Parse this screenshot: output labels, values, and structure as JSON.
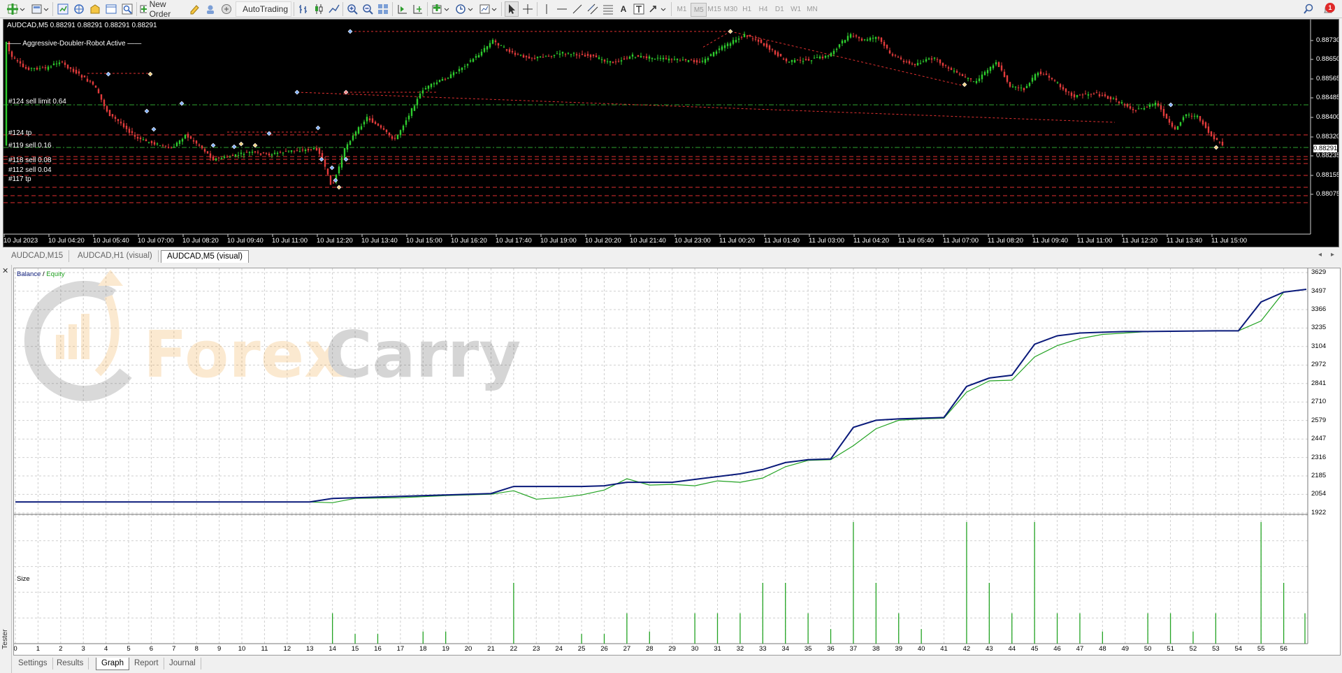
{
  "toolbar": {
    "new_order_label": "New Order",
    "autotrading_label": "AutoTrading",
    "timeframes": [
      "M1",
      "M5",
      "M15",
      "M30",
      "H1",
      "H4",
      "D1",
      "W1",
      "MN"
    ],
    "active_timeframe": "M5",
    "notification_count": "1",
    "icons": [
      "new-chart-icon",
      "profiles-icon",
      "market-watch-icon",
      "navigator-icon",
      "data-window-icon",
      "terminal-icon",
      "strategy-tester-icon",
      "metaeditor-icon",
      "signals-icon",
      "market-icon",
      "bar-chart-icon",
      "candlestick-icon",
      "line-chart-icon",
      "zoom-in-icon",
      "zoom-out-icon",
      "tile-windows-icon",
      "autoscroll-icon",
      "chart-shift-icon",
      "indicators-icon",
      "periods-icon",
      "templates-icon",
      "cursor-icon",
      "crosshair-icon",
      "vertical-line-icon",
      "horizontal-line-icon",
      "trendline-icon",
      "equidistant-channel-icon",
      "fibonacci-icon",
      "text-icon",
      "text-label-icon",
      "arrows-icon",
      "search-icon",
      "notifications-icon"
    ]
  },
  "chart": {
    "title": "AUDCAD,M5  0.88291 0.88291 0.88291 0.88291",
    "robot_label": "Aggressive-Doubler-Robot Active",
    "price_ticks": [
      "0.88730",
      "0.88650",
      "0.88565",
      "0.88485",
      "0.88400",
      "0.88320",
      "0.88235",
      "0.88155",
      "0.88075"
    ],
    "current_price": "0.88291",
    "time_ticks": [
      "10 Jul 2023",
      "10 Jul 04:20",
      "10 Jul 05:40",
      "10 Jul 07:00",
      "10 Jul 08:20",
      "10 Jul 09:40",
      "10 Jul 11:00",
      "10 Jul 12:20",
      "10 Jul 13:40",
      "10 Jul 15:00",
      "10 Jul 16:20",
      "10 Jul 17:40",
      "10 Jul 19:00",
      "10 Jul 20:20",
      "10 Jul 21:40",
      "10 Jul 23:00",
      "11 Jul 00:20",
      "11 Jul 01:40",
      "11 Jul 03:00",
      "11 Jul 04:20",
      "11 Jul 05:40",
      "11 Jul 07:00",
      "11 Jul 08:20",
      "11 Jul 09:40",
      "11 Jul 11:00",
      "11 Jul 12:20",
      "11 Jul 13:40",
      "11 Jul 15:00"
    ],
    "order_labels": [
      "#124 sell limit 0.64",
      "#124 tp",
      "#119 sell 0.16",
      "#118 sell 0.08",
      "#112 sell 0.04",
      "#117 tp"
    ],
    "colors": {
      "bull": "#2ecc2e",
      "bear": "#e23b3b",
      "order_line": "#e03030",
      "limit_line": "#2fa52f"
    }
  },
  "chart_tabs": [
    {
      "label": "AUDCAD,M15",
      "active": false
    },
    {
      "label": "AUDCAD,H1 (visual)",
      "active": false
    },
    {
      "label": "AUDCAD,M5 (visual)",
      "active": true
    }
  ],
  "tester": {
    "side_label": "Tester",
    "legend_balance": "Balance",
    "legend_sep": " / ",
    "legend_equity": "Equity",
    "size_label": "Size",
    "watermark_text": "ForexCarry",
    "tabs": [
      "Settings",
      "Results",
      "Graph",
      "Report",
      "Journal"
    ],
    "active_tab": "Graph",
    "colors": {
      "balance": "#0a1a7a",
      "equity": "#23a323",
      "size": "#23a323",
      "grid": "#cfcfcf"
    }
  },
  "chart_data": {
    "type": "line",
    "title": "",
    "ylim": [
      1922,
      3629
    ],
    "y_ticks": [
      3629,
      3497,
      3366,
      3235,
      3104,
      2972,
      2841,
      2710,
      2579,
      2447,
      2316,
      2185,
      2054,
      1922
    ],
    "x_ticks": [
      0,
      1,
      2,
      3,
      4,
      5,
      6,
      7,
      8,
      9,
      10,
      11,
      12,
      13,
      14,
      15,
      16,
      17,
      18,
      19,
      20,
      21,
      22,
      23,
      24,
      25,
      26,
      27,
      28,
      29,
      30,
      31,
      32,
      33,
      34,
      35,
      36,
      37,
      38,
      39,
      40,
      41,
      42,
      43,
      44,
      45,
      46,
      47,
      48,
      49,
      50,
      51,
      52,
      53,
      54,
      55,
      56
    ],
    "xlim": [
      0,
      57
    ],
    "series": [
      {
        "name": "Balance",
        "x": [
          0,
          13,
          14,
          15,
          17,
          19,
          21,
          22,
          25,
          26,
          27,
          29,
          30,
          31,
          32,
          33,
          34,
          35,
          36,
          37,
          38,
          39,
          40,
          41,
          42,
          43,
          44,
          45,
          46,
          47,
          48,
          49,
          50,
          53,
          54,
          55,
          56,
          57
        ],
        "y": [
          2000,
          2000,
          2025,
          2030,
          2040,
          2050,
          2060,
          2110,
          2110,
          2115,
          2140,
          2140,
          2160,
          2180,
          2200,
          2230,
          2280,
          2300,
          2305,
          2530,
          2580,
          2590,
          2595,
          2600,
          2820,
          2880,
          2900,
          3120,
          3180,
          3200,
          3205,
          3210,
          3210,
          3215,
          3215,
          3420,
          3490,
          3510
        ]
      },
      {
        "name": "Equity",
        "x": [
          0,
          13,
          14,
          15,
          17,
          19,
          21,
          22,
          23,
          24,
          25,
          26,
          27,
          28,
          29,
          30,
          31,
          32,
          33,
          34,
          35,
          36,
          37,
          38,
          39,
          40,
          41,
          42,
          43,
          44,
          45,
          46,
          47,
          48,
          49,
          50,
          53,
          54,
          55,
          56,
          57
        ],
        "y": [
          2000,
          2000,
          1995,
          2025,
          2030,
          2045,
          2055,
          2080,
          2020,
          2030,
          2050,
          2085,
          2165,
          2120,
          2125,
          2115,
          2150,
          2140,
          2170,
          2250,
          2295,
          2300,
          2400,
          2520,
          2580,
          2590,
          2595,
          2780,
          2860,
          2865,
          3030,
          3110,
          3160,
          3190,
          3200,
          3210,
          3215,
          3215,
          3285,
          3490,
          3510
        ]
      }
    ],
    "size_bars": {
      "name": "Size",
      "x": [
        14,
        15,
        16,
        18,
        19,
        22,
        25,
        26,
        27,
        28,
        30,
        31,
        32,
        33,
        34,
        35,
        36,
        37,
        38,
        39,
        40,
        42,
        43,
        44,
        45,
        46,
        47,
        48,
        50,
        51,
        52,
        53,
        55,
        56,
        57
      ],
      "y": [
        0.25,
        0.08,
        0.08,
        0.1,
        0.1,
        0.5,
        0.08,
        0.08,
        0.25,
        0.1,
        0.25,
        0.25,
        0.25,
        0.5,
        0.5,
        0.25,
        0.12,
        1.0,
        0.5,
        0.25,
        0.12,
        1.0,
        0.5,
        0.25,
        1.0,
        0.25,
        0.25,
        0.1,
        0.25,
        0.25,
        0.1,
        0.25,
        1.0,
        0.5,
        0.25
      ]
    }
  }
}
